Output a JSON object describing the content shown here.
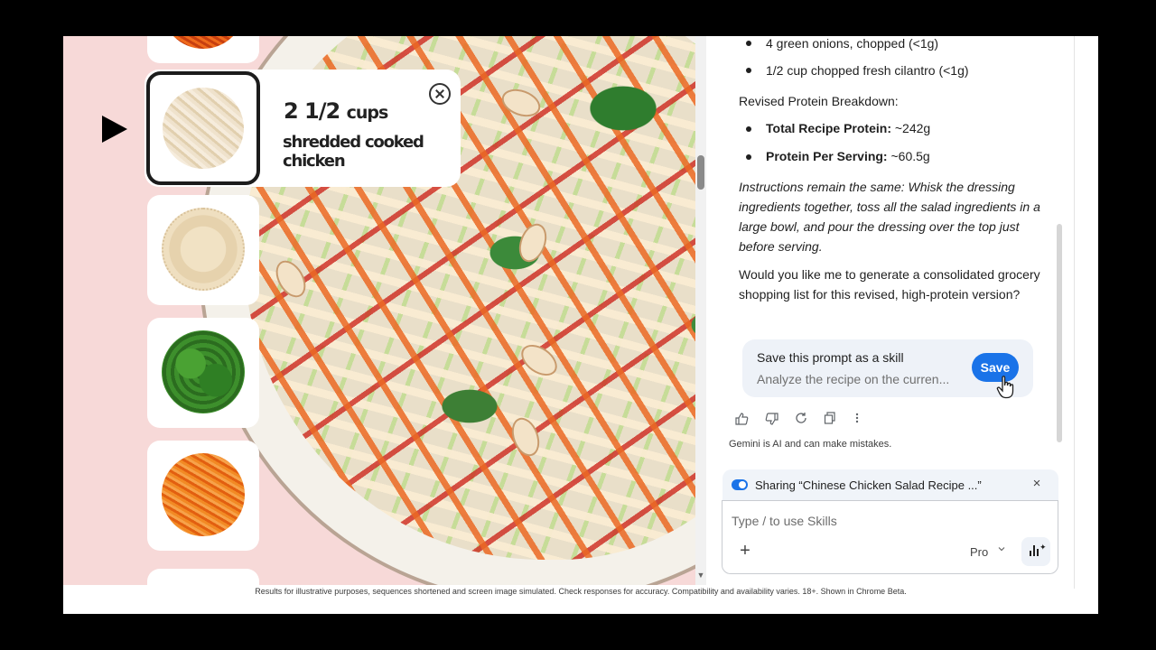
{
  "recipe_page": {
    "ingredient_popup": {
      "quantity": "2 1/2",
      "unit": "cups",
      "name": "shredded cooked chicken"
    },
    "thumbnails": [
      "carrot",
      "chicken",
      "almond",
      "cilantro",
      "carrot"
    ],
    "scroll_arrow": "▼"
  },
  "chat": {
    "bullets_top": [
      "4 green onions, chopped (<1g)",
      "1/2 cup chopped fresh cilantro (<1g)"
    ],
    "protein_heading": "Revised Protein Breakdown:",
    "protein_items": [
      {
        "label": "Total Recipe Protein:",
        "value": " ~242g"
      },
      {
        "label": "Protein Per Serving:",
        "value": " ~60.5g"
      }
    ],
    "instructions": "Instructions remain the same: Whisk the dressing ingredients together, toss all the salad ingredients in a large bowl, and pour the dressing over the top just before serving.",
    "question": "Would you like me to generate a consolidated grocery shopping list for this revised, high-protein version?",
    "skill": {
      "title": "Save this prompt as a skill",
      "subtitle": "Analyze the recipe on the curren...",
      "save_label": "Save"
    },
    "actions": [
      "thumbs-up",
      "thumbs-down",
      "regenerate",
      "copy",
      "more"
    ],
    "ai_note": "Gemini is AI and can make mistakes."
  },
  "share": {
    "text": "Sharing “Chinese Chicken Salad Recipe ...”",
    "close": "×"
  },
  "composer": {
    "placeholder": "Type / to use Skills",
    "model": "Pro",
    "plus": "+"
  },
  "footer": {
    "disclaimer": "Results for illustrative purposes, sequences shortened and screen image simulated. Check responses for accuracy. Compatibility and availability varies. 18+. Shown in Chrome Beta."
  },
  "colors": {
    "accent": "#1a73e8",
    "page_bg": "#f7d9d8",
    "skill_card": "#eef2f8"
  }
}
